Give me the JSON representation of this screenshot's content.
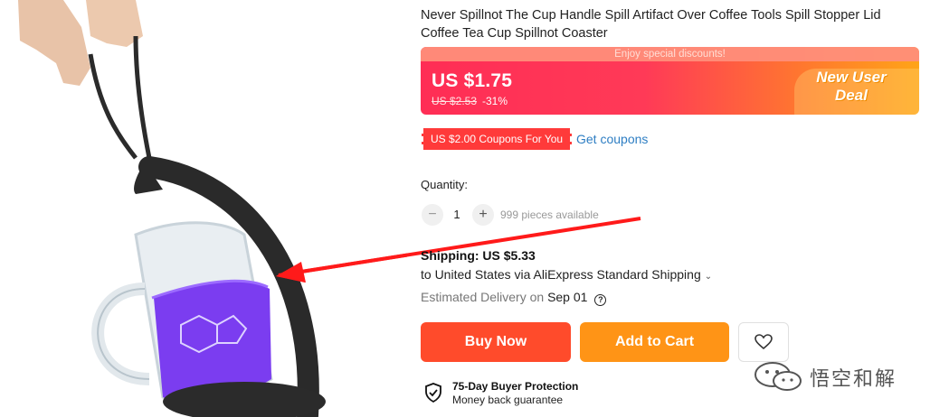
{
  "product": {
    "title": "Never Spillnot The Cup Handle Spill Artifact Over Coffee Tools Spill Stopper Lid Coffee Tea Cup Spillnot Coaster",
    "image_icon": "product-photo-glass-mug-with-handle-strap"
  },
  "price": {
    "promo_strip": "Enjoy special discounts!",
    "current": "US $1.75",
    "original": "US $2.53",
    "discount": "-31%",
    "deal_badge": "New User Deal",
    "colors": {
      "gradient_start": "#ff2d55",
      "gradient_end": "#ffa418"
    }
  },
  "coupon": {
    "badge": "US $2.00 Coupons For You",
    "link": "Get coupons",
    "colors": {
      "badge": "#ff3a3a",
      "link": "#2e7ec3"
    }
  },
  "quantity": {
    "label": "Quantity:",
    "value": "1",
    "minus_icon": "minus-icon",
    "plus_icon": "plus-icon",
    "available": "999 pieces available"
  },
  "shipping": {
    "title": "Shipping: US $5.33",
    "destination": "to United States via AliExpress Standard Shipping",
    "delivery_label": "Estimated Delivery on",
    "delivery_date": "Sep 01"
  },
  "actions": {
    "buy_now": "Buy Now",
    "add_to_cart": "Add to Cart",
    "wishlist_icon": "heart-icon",
    "colors": {
      "buy_now": "#ff4b2b",
      "add_to_cart": "#ff9416"
    }
  },
  "protection": {
    "title": "75-Day Buyer Protection",
    "subtitle": "Money back guarantee"
  },
  "watermark": {
    "text": "悟空和解"
  },
  "annotation": {
    "arrow_color": "#ff1a1a"
  }
}
